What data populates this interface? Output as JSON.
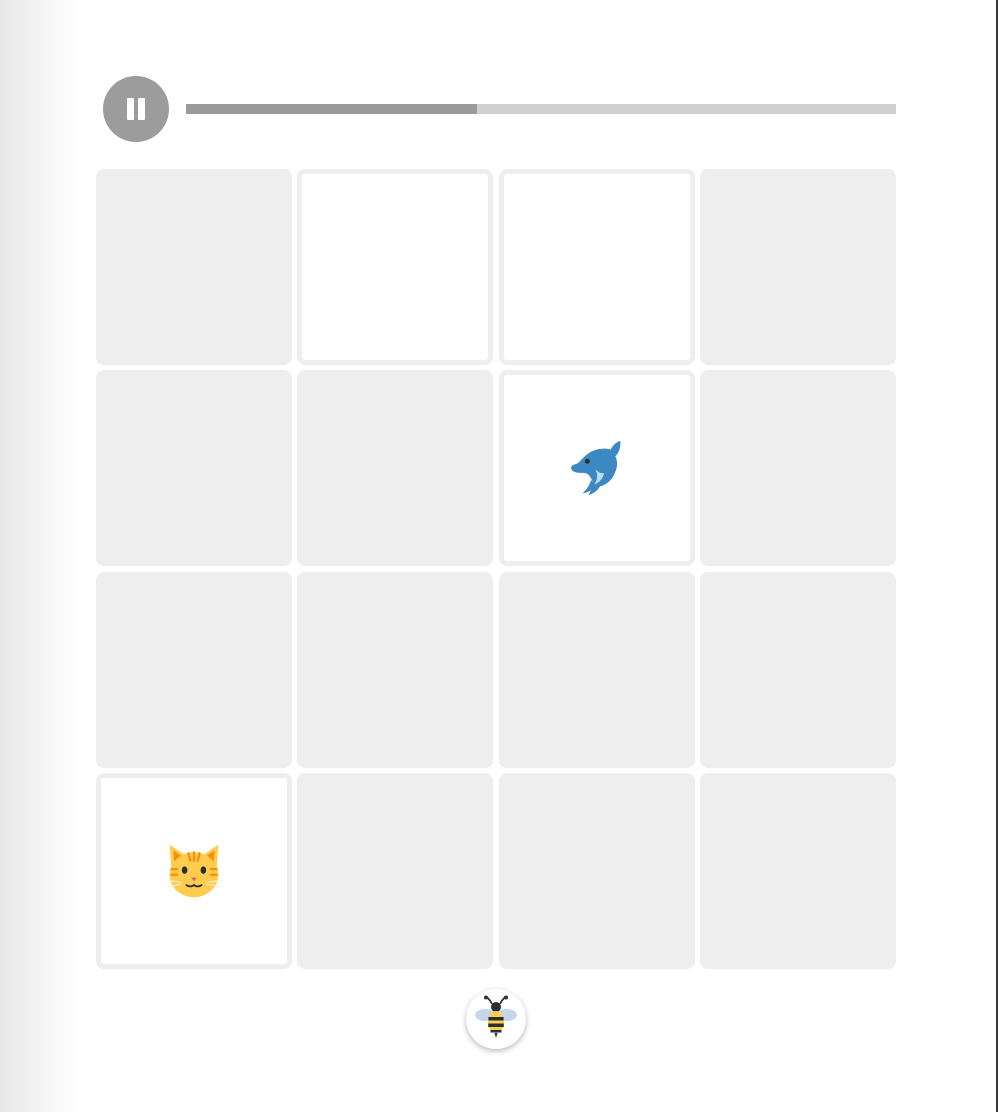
{
  "progress": {
    "fraction": 0.41
  },
  "grid": {
    "rows": 4,
    "cols": 4,
    "tiles": [
      {
        "state": "hidden",
        "icon": ""
      },
      {
        "state": "revealed",
        "icon": ""
      },
      {
        "state": "revealed",
        "icon": ""
      },
      {
        "state": "hidden",
        "icon": ""
      },
      {
        "state": "hidden",
        "icon": ""
      },
      {
        "state": "hidden",
        "icon": ""
      },
      {
        "state": "revealed",
        "icon": "dolphin-icon"
      },
      {
        "state": "hidden",
        "icon": ""
      },
      {
        "state": "hidden",
        "icon": ""
      },
      {
        "state": "hidden",
        "icon": ""
      },
      {
        "state": "hidden",
        "icon": ""
      },
      {
        "state": "hidden",
        "icon": ""
      },
      {
        "state": "revealed",
        "icon": "cat-face-icon"
      },
      {
        "state": "hidden",
        "icon": ""
      },
      {
        "state": "hidden",
        "icon": ""
      },
      {
        "state": "hidden",
        "icon": ""
      }
    ]
  },
  "target": {
    "icon": "bee-icon"
  },
  "colors": {
    "tile_hidden": "#eeeeee",
    "tile_revealed": "#ffffff",
    "pause_button": "#9c9c9c",
    "progress_fill": "#9a9a9a",
    "progress_track": "#d0d0d0"
  }
}
